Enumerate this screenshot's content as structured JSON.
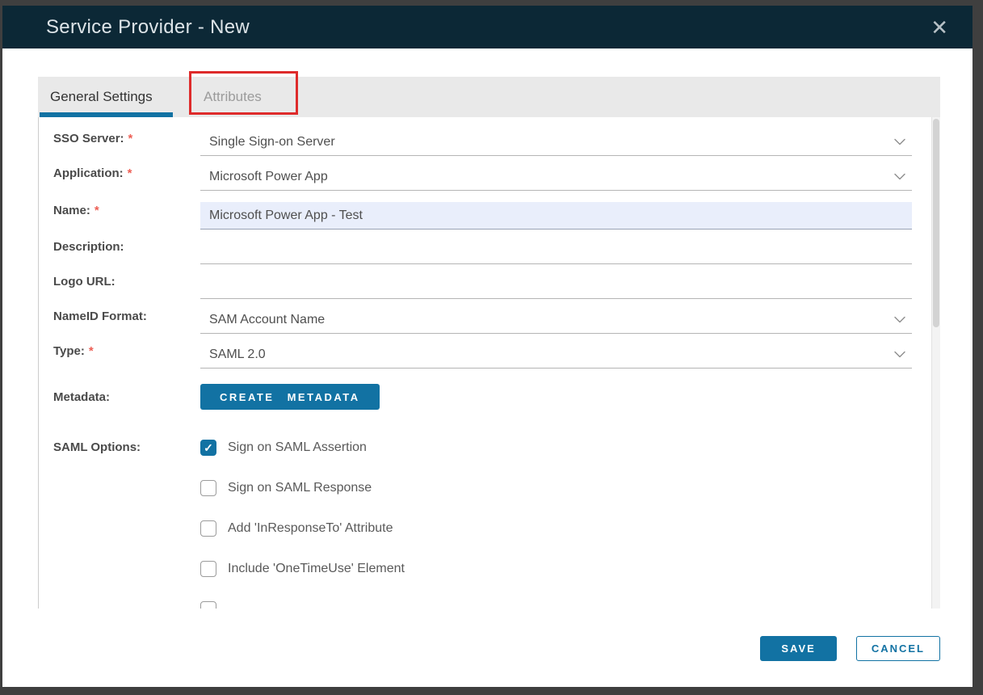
{
  "window": {
    "title": "Service Provider - New"
  },
  "icons": {
    "close": "✕",
    "check": "✓",
    "chevron_down": "v"
  },
  "tabs": {
    "general": "General Settings",
    "attributes": "Attributes"
  },
  "form": {
    "fields": [
      {
        "label": "SSO Server:",
        "required": true,
        "value": "Single Sign-on Server",
        "type": "select",
        "highlighted": false
      },
      {
        "label": "Application:",
        "required": true,
        "value": "Microsoft Power App",
        "type": "select",
        "highlighted": false
      },
      {
        "label": "Name:",
        "required": true,
        "value": "Microsoft Power App - Test",
        "type": "text",
        "highlighted": true
      },
      {
        "label": "Description:",
        "required": false,
        "value": "",
        "type": "text",
        "highlighted": false
      },
      {
        "label": "Logo URL:",
        "required": false,
        "value": "",
        "type": "text",
        "highlighted": false
      },
      {
        "label": "NameID Format:",
        "required": false,
        "value": "SAM Account Name",
        "type": "select",
        "highlighted": false
      },
      {
        "label": "Type:",
        "required": true,
        "value": "SAML 2.0",
        "type": "select",
        "highlighted": false
      }
    ],
    "metadata": {
      "label": "Metadata:",
      "button_label": "CREATE METADATA"
    },
    "saml_options": {
      "label": "SAML Options:",
      "options": [
        {
          "label": "Sign on SAML Assertion",
          "checked": true,
          "partial": false
        },
        {
          "label": "Sign on SAML Response",
          "checked": false,
          "partial": false
        },
        {
          "label": "Add 'InResponseTo' Attribute",
          "checked": false,
          "partial": false
        },
        {
          "label": "Include 'OneTimeUse' Element",
          "checked": false,
          "partial": false
        },
        {
          "label": "",
          "checked": false,
          "partial": true
        }
      ]
    }
  },
  "footer": {
    "save_label": "SAVE",
    "cancel_label": "CANCEL"
  },
  "colors": {
    "accent": "#1272a3",
    "header-bg": "#0c2836",
    "annotation-red": "#de2b2b",
    "highlight-bg": "#e9eefb",
    "frame": "#3f3f3f"
  }
}
